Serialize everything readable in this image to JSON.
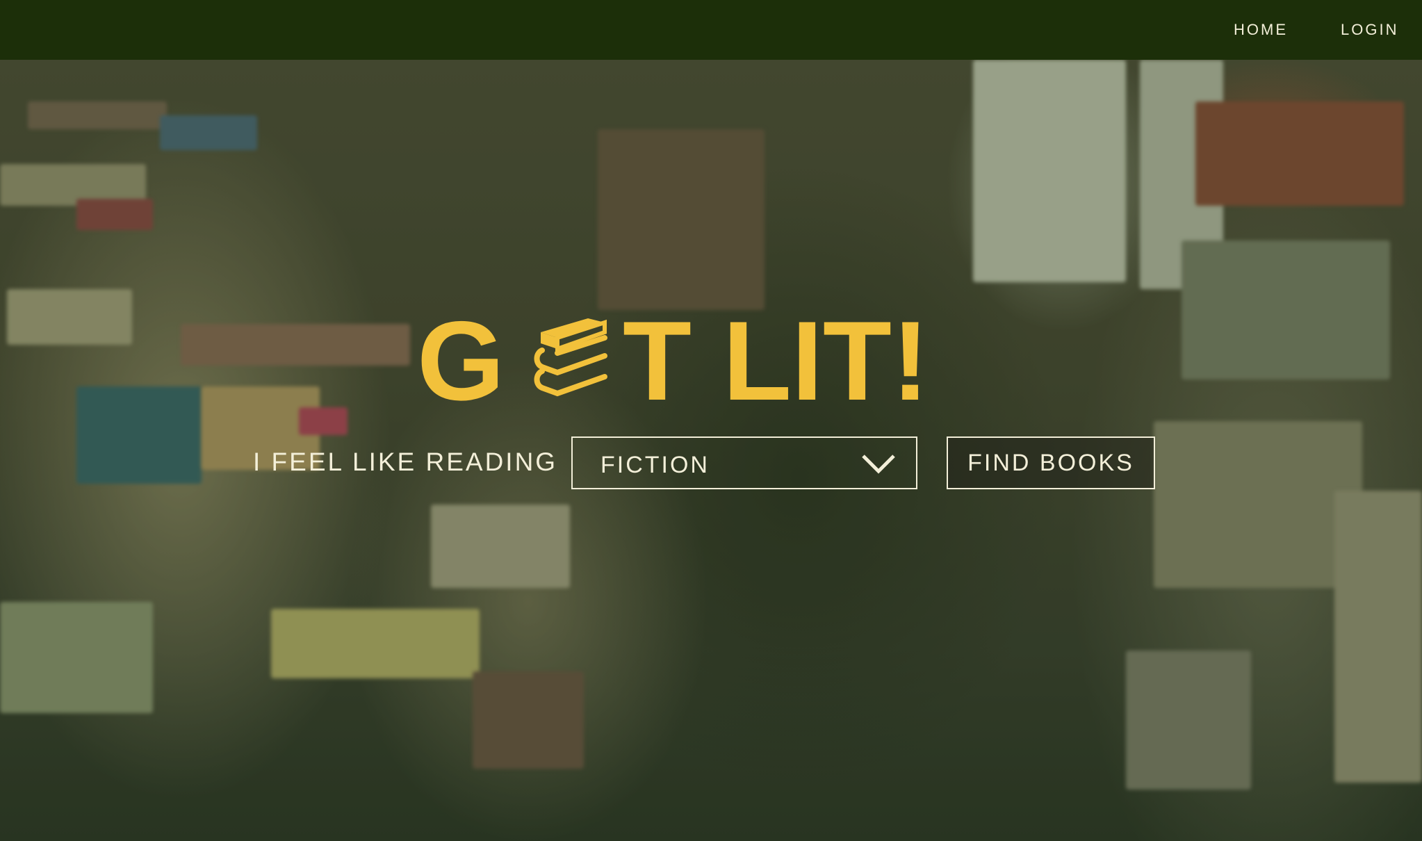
{
  "nav": {
    "home_label": "HOME",
    "login_label": "LOGIN"
  },
  "hero": {
    "logo": {
      "prefix": "G",
      "suffix": "T LIT!",
      "book_icon": "book-stack-icon",
      "color": "#f2c13b"
    },
    "prompt_label": "I FEEL LIKE READING",
    "genre_select": {
      "value": "FICTION",
      "icon": "chevron-down-icon"
    },
    "find_button_label": "FIND BOOKS"
  },
  "colors": {
    "nav_background": "#1c2f09",
    "text": "#f3efd9",
    "accent": "#f2c13b"
  }
}
